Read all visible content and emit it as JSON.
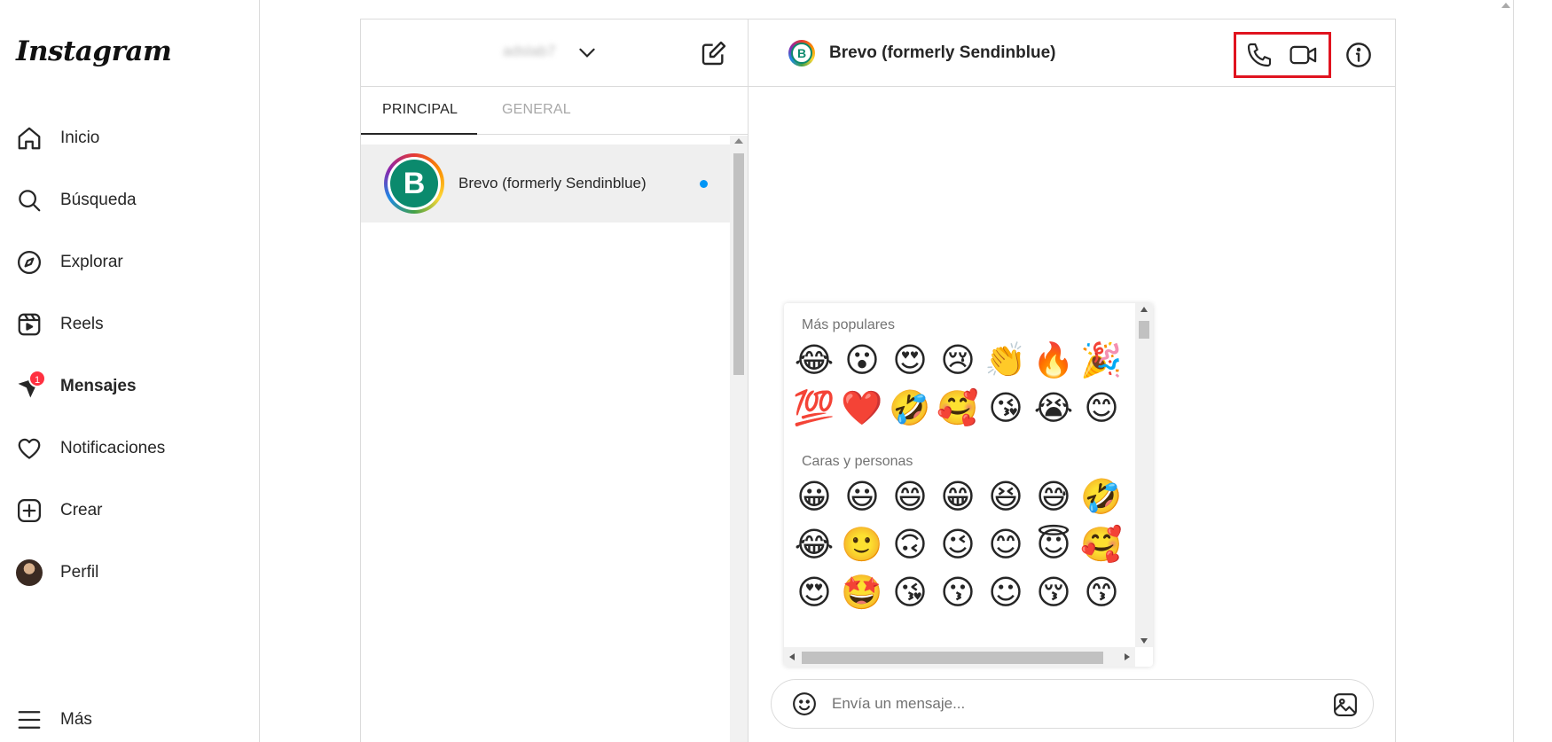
{
  "app": {
    "logo_text": "Instagram"
  },
  "nav": {
    "items": [
      {
        "label": "Inicio",
        "icon": "home-icon"
      },
      {
        "label": "Búsqueda",
        "icon": "search-icon"
      },
      {
        "label": "Explorar",
        "icon": "compass-icon"
      },
      {
        "label": "Reels",
        "icon": "reels-icon"
      },
      {
        "label": "Mensajes",
        "icon": "messenger-icon",
        "badge": "1",
        "active": true
      },
      {
        "label": "Notificaciones",
        "icon": "heart-icon"
      },
      {
        "label": "Crear",
        "icon": "plus-square-icon"
      },
      {
        "label": "Perfil",
        "icon": "avatar"
      }
    ],
    "more_label": "Más"
  },
  "inbox": {
    "account_name": "adslab7",
    "tabs": [
      {
        "label": "PRINCIPAL",
        "active": true
      },
      {
        "label": "GENERAL",
        "active": false
      }
    ],
    "threads": [
      {
        "name": "Brevo (formerly Sendinblue)",
        "avatar_letter": "B",
        "unread": true
      }
    ]
  },
  "conversation": {
    "title": "Brevo (formerly Sendinblue)",
    "avatar_letter": "B",
    "header_icons": [
      "phone-icon",
      "video-icon",
      "info-icon"
    ],
    "highlight_color": "#e0131f"
  },
  "emoji_picker": {
    "sections": [
      {
        "title": "Más populares",
        "rows": [
          [
            "😂",
            "😮",
            "😍",
            "😢",
            "👏",
            "🔥",
            "🎉"
          ],
          [
            "💯",
            "❤️",
            "🤣",
            "🥰",
            "😘",
            "😭",
            "😊"
          ]
        ]
      },
      {
        "title": "Caras y personas",
        "rows": [
          [
            "😀",
            "😃",
            "😄",
            "😁",
            "😆",
            "😅",
            "🤣"
          ],
          [
            "😂",
            "🙂",
            "🙃",
            "😉",
            "😊",
            "😇",
            "🥰"
          ],
          [
            "😍",
            "🤩",
            "😘",
            "😗",
            "☺",
            "😚",
            "😙"
          ]
        ]
      }
    ]
  },
  "composer": {
    "placeholder": "Envía un mensaje..."
  },
  "colors": {
    "accent_blue": "#0095f6",
    "badge_red": "#ff3040",
    "brevo_green": "#0b8a6d"
  }
}
